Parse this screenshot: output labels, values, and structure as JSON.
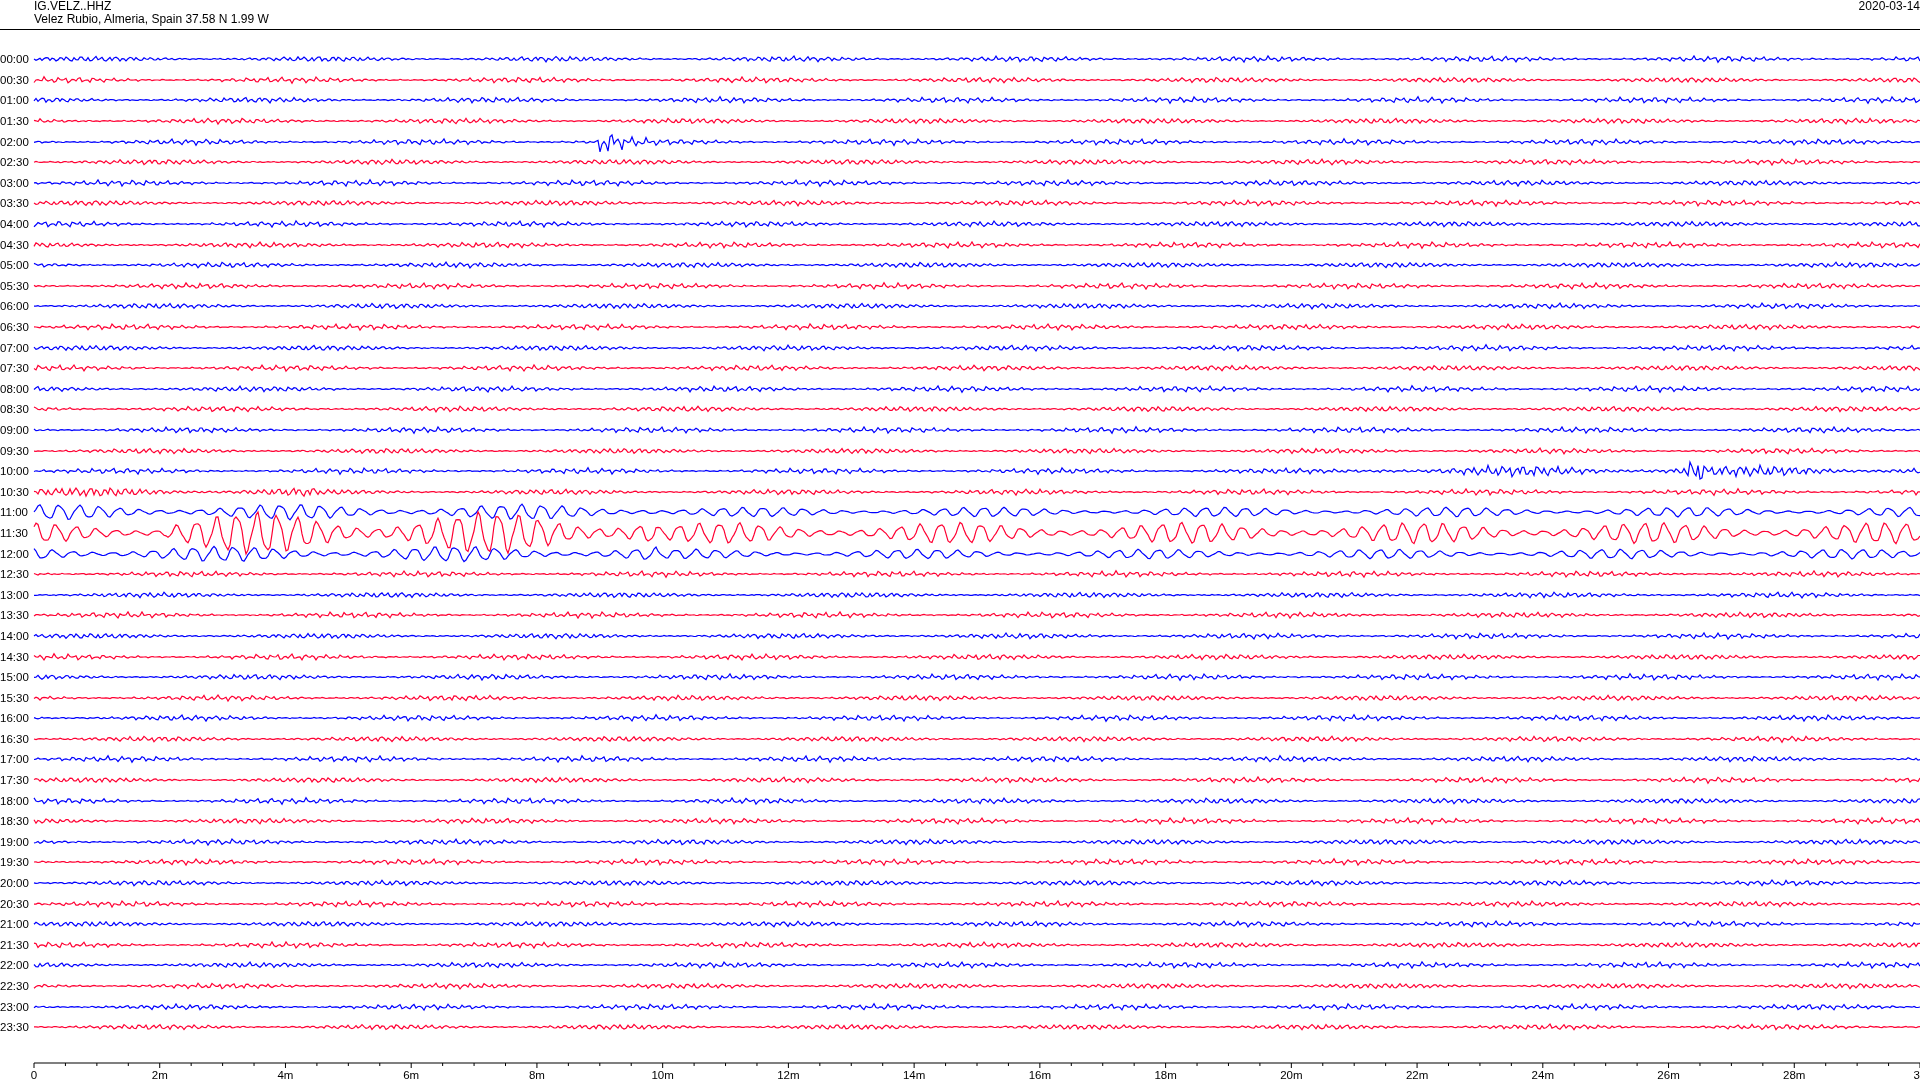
{
  "header": {
    "station": "IG.VELZ..HHZ",
    "location": "Velez Rubio, Almeria, Spain  37.58 N 1.99 W",
    "date": "2020-03-14"
  },
  "rows": [
    {
      "label": "00:00",
      "color": "#0000ff",
      "kind": "quiet"
    },
    {
      "label": "00:30",
      "color": "#ff0033",
      "kind": "quiet"
    },
    {
      "label": "01:00",
      "color": "#0000ff",
      "kind": "quiet"
    },
    {
      "label": "01:30",
      "color": "#ff0033",
      "kind": "quiet"
    },
    {
      "label": "02:00",
      "color": "#0000ff",
      "kind": "quake"
    },
    {
      "label": "02:30",
      "color": "#ff0033",
      "kind": "quiet"
    },
    {
      "label": "03:00",
      "color": "#0000ff",
      "kind": "quiet"
    },
    {
      "label": "03:30",
      "color": "#ff0033",
      "kind": "quiet"
    },
    {
      "label": "04:00",
      "color": "#0000ff",
      "kind": "quiet"
    },
    {
      "label": "04:30",
      "color": "#ff0033",
      "kind": "quiet"
    },
    {
      "label": "05:00",
      "color": "#0000ff",
      "kind": "quiet"
    },
    {
      "label": "05:30",
      "color": "#ff0033",
      "kind": "quiet"
    },
    {
      "label": "06:00",
      "color": "#0000ff",
      "kind": "quiet"
    },
    {
      "label": "06:30",
      "color": "#ff0033",
      "kind": "quiet"
    },
    {
      "label": "07:00",
      "color": "#0000ff",
      "kind": "quiet"
    },
    {
      "label": "07:30",
      "color": "#ff0033",
      "kind": "quiet"
    },
    {
      "label": "08:00",
      "color": "#0000ff",
      "kind": "quiet"
    },
    {
      "label": "08:30",
      "color": "#ff0033",
      "kind": "quiet"
    },
    {
      "label": "09:00",
      "color": "#0000ff",
      "kind": "quiet"
    },
    {
      "label": "09:30",
      "color": "#ff0033",
      "kind": "quiet"
    },
    {
      "label": "10:00",
      "color": "#0000ff",
      "kind": "noisy"
    },
    {
      "label": "10:30",
      "color": "#ff0033",
      "kind": "rising"
    },
    {
      "label": "11:00",
      "color": "#0000ff",
      "kind": "swell"
    },
    {
      "label": "11:30",
      "color": "#ff0033",
      "kind": "storm"
    },
    {
      "label": "12:00",
      "color": "#0000ff",
      "kind": "swell"
    },
    {
      "label": "12:30",
      "color": "#ff0033",
      "kind": "quiet"
    },
    {
      "label": "13:00",
      "color": "#0000ff",
      "kind": "quiet"
    },
    {
      "label": "13:30",
      "color": "#ff0033",
      "kind": "quiet"
    },
    {
      "label": "14:00",
      "color": "#0000ff",
      "kind": "quiet"
    },
    {
      "label": "14:30",
      "color": "#ff0033",
      "kind": "quiet"
    },
    {
      "label": "15:00",
      "color": "#0000ff",
      "kind": "quiet"
    },
    {
      "label": "15:30",
      "color": "#ff0033",
      "kind": "quiet"
    },
    {
      "label": "16:00",
      "color": "#0000ff",
      "kind": "quiet"
    },
    {
      "label": "16:30",
      "color": "#ff0033",
      "kind": "quiet"
    },
    {
      "label": "17:00",
      "color": "#0000ff",
      "kind": "quiet"
    },
    {
      "label": "17:30",
      "color": "#ff0033",
      "kind": "quiet"
    },
    {
      "label": "18:00",
      "color": "#0000ff",
      "kind": "quiet"
    },
    {
      "label": "18:30",
      "color": "#ff0033",
      "kind": "quiet"
    },
    {
      "label": "19:00",
      "color": "#0000ff",
      "kind": "quiet"
    },
    {
      "label": "19:30",
      "color": "#ff0033",
      "kind": "quiet"
    },
    {
      "label": "20:00",
      "color": "#0000ff",
      "kind": "quiet"
    },
    {
      "label": "20:30",
      "color": "#ff0033",
      "kind": "quiet"
    },
    {
      "label": "21:00",
      "color": "#0000ff",
      "kind": "quiet"
    },
    {
      "label": "21:30",
      "color": "#ff0033",
      "kind": "quiet"
    },
    {
      "label": "22:00",
      "color": "#0000ff",
      "kind": "quiet"
    },
    {
      "label": "22:30",
      "color": "#ff0033",
      "kind": "quiet"
    },
    {
      "label": "23:00",
      "color": "#0000ff",
      "kind": "quiet"
    },
    {
      "label": "23:30",
      "color": "#ff0033",
      "kind": "quiet"
    }
  ],
  "x_axis": {
    "ticks": [
      "0",
      "2m",
      "4m",
      "6m",
      "8m",
      "10m",
      "12m",
      "14m",
      "16m",
      "18m",
      "20m",
      "22m",
      "24m",
      "26m",
      "28m",
      "3"
    ]
  }
}
